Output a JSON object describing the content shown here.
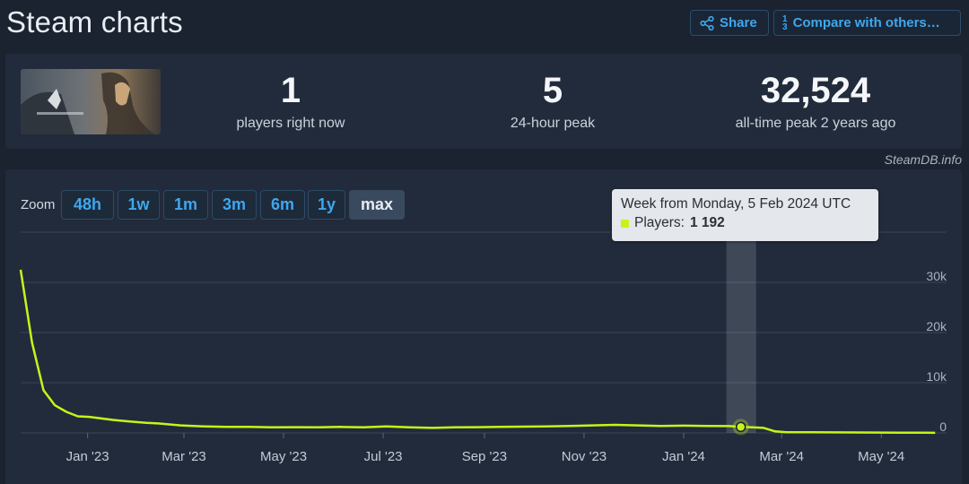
{
  "page": {
    "title": "Steam charts"
  },
  "toolbar": {
    "share_label": "Share",
    "compare_label": "Compare with others…",
    "compare_icon_top": "1",
    "compare_icon_bottom": "3"
  },
  "stats": [
    {
      "value": "1",
      "label": "players right now"
    },
    {
      "value": "5",
      "label": "24-hour peak"
    },
    {
      "value": "32,524",
      "label": "all-time peak 2 years ago"
    }
  ],
  "credit": "SteamDB.info",
  "zoom": {
    "label": "Zoom",
    "options": [
      "48h",
      "1w",
      "1m",
      "3m",
      "6m",
      "1y",
      "max"
    ],
    "active": "max"
  },
  "tooltip": {
    "title": "Week from Monday, 5 Feb 2024 UTC",
    "series_label": "Players:",
    "value": "1 192"
  },
  "colors": {
    "line": "#c6f41a",
    "accent": "#3fa7ee",
    "background": "#1b2230",
    "panel": "#222b3b"
  },
  "chart_data": {
    "type": "line",
    "series": [
      {
        "name": "Players",
        "x": [
          "2022-11-21",
          "2022-11-28",
          "2022-12-05",
          "2022-12-12",
          "2022-12-19",
          "2022-12-26",
          "2023-01-02",
          "2023-01-09",
          "2023-01-16",
          "2023-01-23",
          "2023-01-30",
          "2023-02-06",
          "2023-02-13",
          "2023-02-20",
          "2023-02-27",
          "2023-03-13",
          "2023-03-27",
          "2023-04-10",
          "2023-04-24",
          "2023-05-08",
          "2023-05-22",
          "2023-06-05",
          "2023-06-19",
          "2023-07-03",
          "2023-07-17",
          "2023-07-31",
          "2023-08-14",
          "2023-08-28",
          "2023-09-11",
          "2023-09-25",
          "2023-10-09",
          "2023-10-23",
          "2023-11-06",
          "2023-11-20",
          "2023-12-04",
          "2023-12-18",
          "2024-01-01",
          "2024-01-15",
          "2024-01-29",
          "2024-02-05",
          "2024-02-12",
          "2024-02-19",
          "2024-02-26",
          "2024-03-04",
          "2024-03-18",
          "2024-04-01",
          "2024-04-15",
          "2024-04-29",
          "2024-05-13",
          "2024-05-27",
          "2024-06-03"
        ],
        "values": [
          32524,
          18000,
          8500,
          5500,
          4200,
          3300,
          3200,
          2900,
          2600,
          2400,
          2200,
          2000,
          1900,
          1700,
          1500,
          1300,
          1200,
          1200,
          1100,
          1150,
          1100,
          1200,
          1100,
          1300,
          1100,
          1000,
          1100,
          1150,
          1200,
          1250,
          1300,
          1400,
          1500,
          1600,
          1500,
          1400,
          1450,
          1400,
          1350,
          1192,
          1100,
          1000,
          300,
          150,
          120,
          100,
          90,
          80,
          60,
          30,
          20
        ]
      }
    ],
    "x_ticks": [
      "Jan '23",
      "Mar '23",
      "May '23",
      "Jul '23",
      "Sep '23",
      "Nov '23",
      "Jan '24",
      "Mar '24",
      "May '24"
    ],
    "y_ticks": [
      "0",
      "10k",
      "20k",
      "30k"
    ],
    "ylim": [
      0,
      40000
    ],
    "xlim": [
      "2022-11-21",
      "2024-06-10"
    ],
    "grid": true,
    "legend": false
  }
}
